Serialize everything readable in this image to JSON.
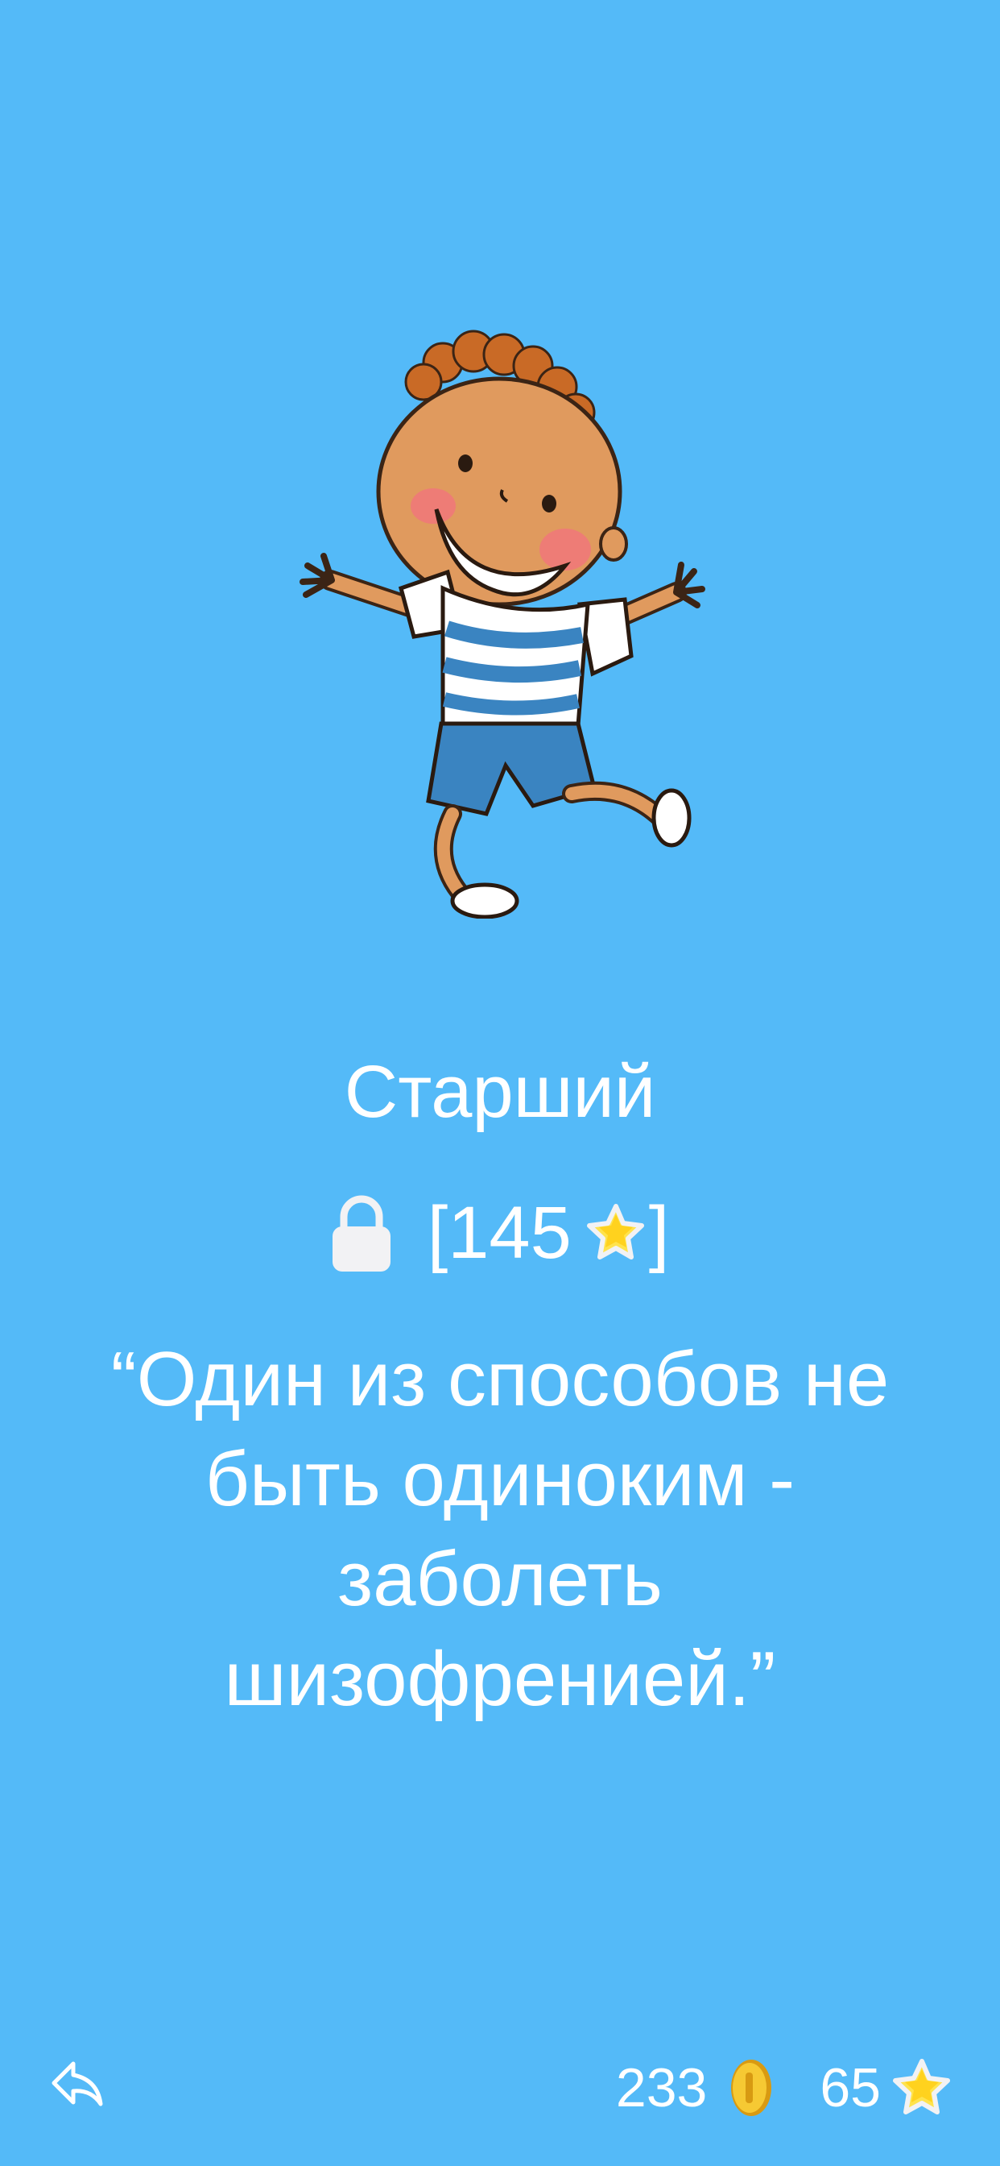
{
  "character": {
    "name": "Старший",
    "locked": true,
    "price_label_open": "[",
    "price": "145",
    "price_label_close": "]",
    "price_icon": "star-icon",
    "image_icon": "running-boy-illustration"
  },
  "quote": {
    "text": "“Один из способов не быть одиноким - заболеть шизофренией.”"
  },
  "footer": {
    "back_icon": "reply-arrow-icon",
    "coins": "233",
    "coins_icon": "coin-icon",
    "stars": "65",
    "stars_icon": "star-icon"
  },
  "colors": {
    "background": "#54BAF8",
    "text": "#FFFFFF",
    "star": "#FFE34D",
    "coin": "#F2C230"
  }
}
